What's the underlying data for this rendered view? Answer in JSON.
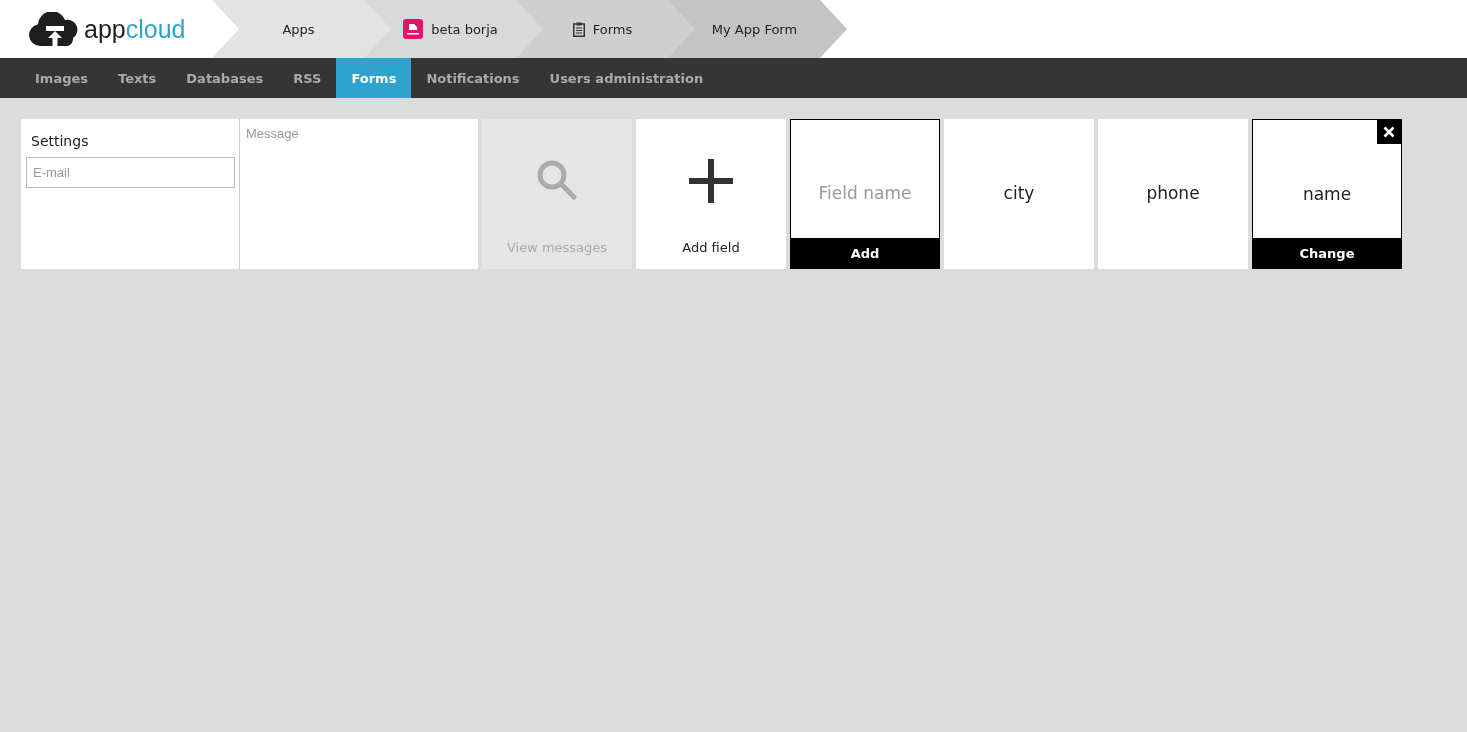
{
  "logo": {
    "text_parts": [
      "app",
      "cloud"
    ]
  },
  "breadcrumbs": [
    {
      "label": "Apps",
      "kind": "plain"
    },
    {
      "label": "beta borja",
      "kind": "app"
    },
    {
      "label": "Forms",
      "kind": "clipboard"
    },
    {
      "label": "My App Form",
      "kind": "plain"
    }
  ],
  "nav_tabs": [
    {
      "label": "Images",
      "selected": false
    },
    {
      "label": "Texts",
      "selected": false
    },
    {
      "label": "Databases",
      "selected": false
    },
    {
      "label": "RSS",
      "selected": false
    },
    {
      "label": "Forms",
      "selected": true
    },
    {
      "label": "Notifications",
      "selected": false
    },
    {
      "label": "Users administration",
      "selected": false
    }
  ],
  "settings": {
    "title": "Settings",
    "email_placeholder": "E-mail",
    "message_placeholder": "Message"
  },
  "view_messages": {
    "label": "View messages"
  },
  "add_field": {
    "label": "Add field"
  },
  "new_field": {
    "placeholder": "Field name",
    "button": "Add"
  },
  "fields": [
    {
      "label": "city",
      "selected": false
    },
    {
      "label": "phone",
      "selected": false
    },
    {
      "label": "name",
      "selected": true,
      "button": "Change"
    }
  ]
}
